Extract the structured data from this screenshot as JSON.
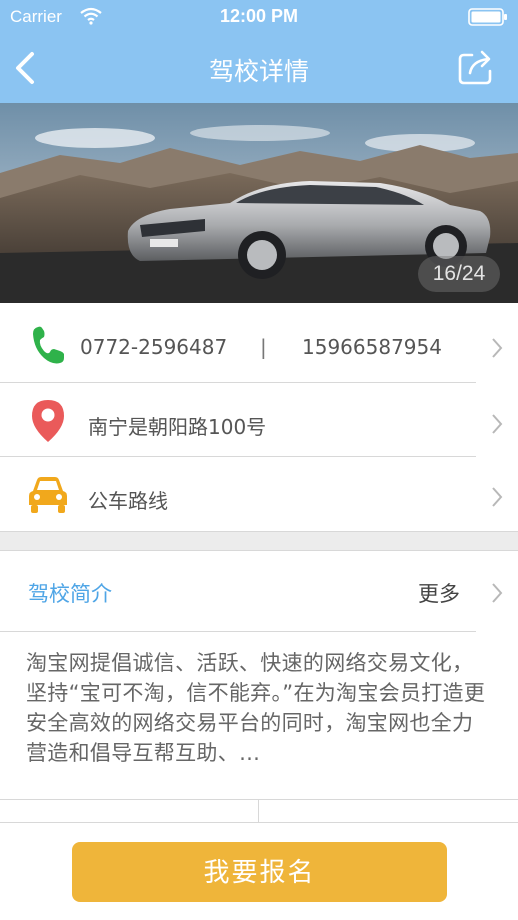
{
  "status": {
    "carrier": "Carrier",
    "time": "12:00 PM"
  },
  "nav": {
    "title": "驾校详情"
  },
  "banner": {
    "counter": "16/24"
  },
  "contact": {
    "phone1": "0772-2596487",
    "separator": "|",
    "phone2": "15966587954"
  },
  "address": {
    "text": "南宁是朝阳路100号"
  },
  "bus": {
    "text": "公车路线"
  },
  "intro": {
    "title": "驾校简介",
    "more": "更多",
    "body": "淘宝网提倡诚信、活跃、快速的网络交易文化，坚持“宝可不淘，信不能弃。”在为淘宝会员打造更安全高效的网络交易平台的同时，淘宝网也全力营造和倡导互帮互助、…"
  },
  "action": {
    "signup": "我要报名"
  },
  "colors": {
    "header": "#8bc4f2",
    "accent_blue": "#4fa5e6",
    "button": "#efb53a",
    "phone_green": "#2fb24a",
    "pin_red": "#ea5a5a",
    "car_orange": "#f1a81c"
  }
}
